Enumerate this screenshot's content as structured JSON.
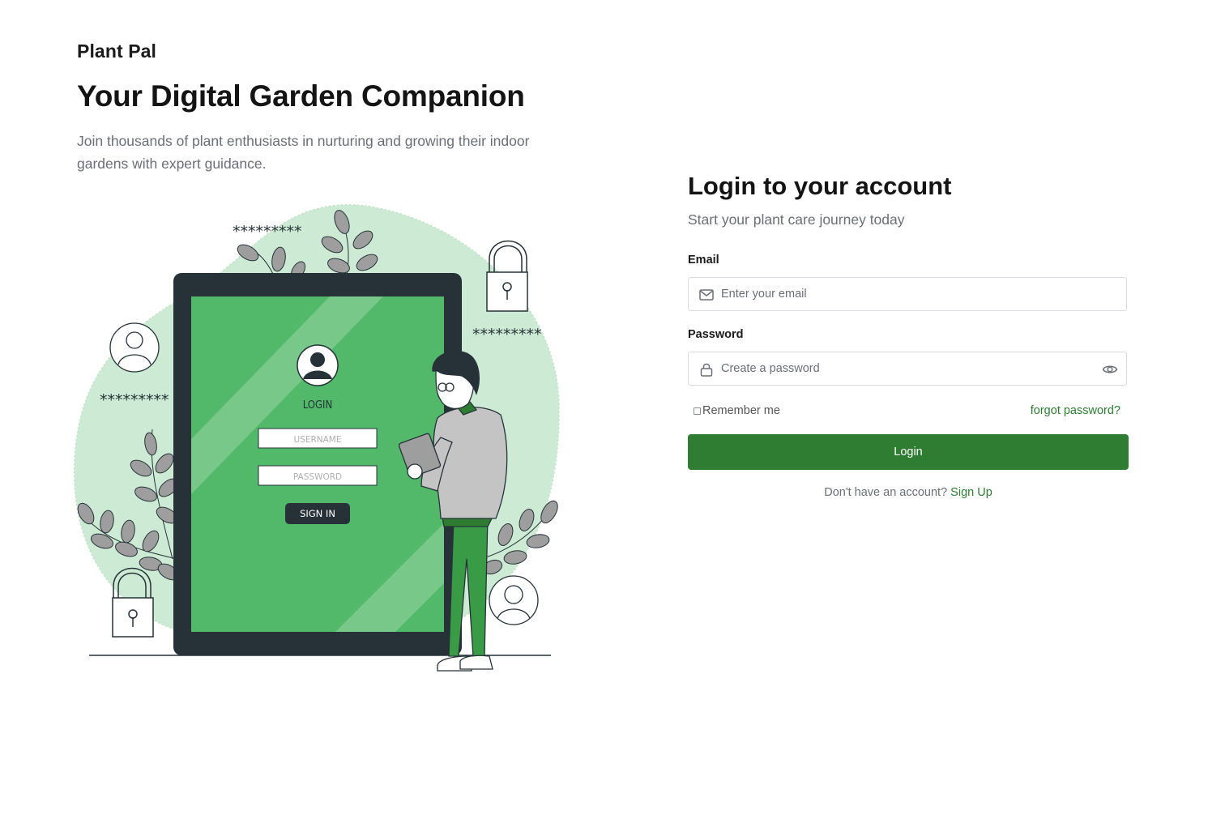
{
  "brand": "Plant Pal",
  "hero": {
    "title": "Your Digital Garden Companion",
    "subtitle": "Join thousands of plant enthusiasts in nurturing and growing their indoor gardens with expert guidance."
  },
  "illustration": {
    "login_heading": "LOGIN",
    "username_placeholder": "USERNAME",
    "password_placeholder": "PASSWORD",
    "sign_in_label": "SIGN IN",
    "masked_text": "*********"
  },
  "login": {
    "title": "Login to your account",
    "subtitle": "Start your plant care journey today",
    "email_label": "Email",
    "email_placeholder": "Enter your email",
    "password_label": "Password",
    "password_placeholder": "Create a password",
    "remember_label": "Remember me",
    "forgot_label": "forgot password?",
    "submit_label": "Login",
    "no_account_text": "Don't have an account?",
    "signup_label": "Sign Up"
  },
  "colors": {
    "accent": "#2e7d32",
    "screen_green": "#52b96a",
    "blob_green": "#cdebd4",
    "device_dark": "#263238"
  }
}
